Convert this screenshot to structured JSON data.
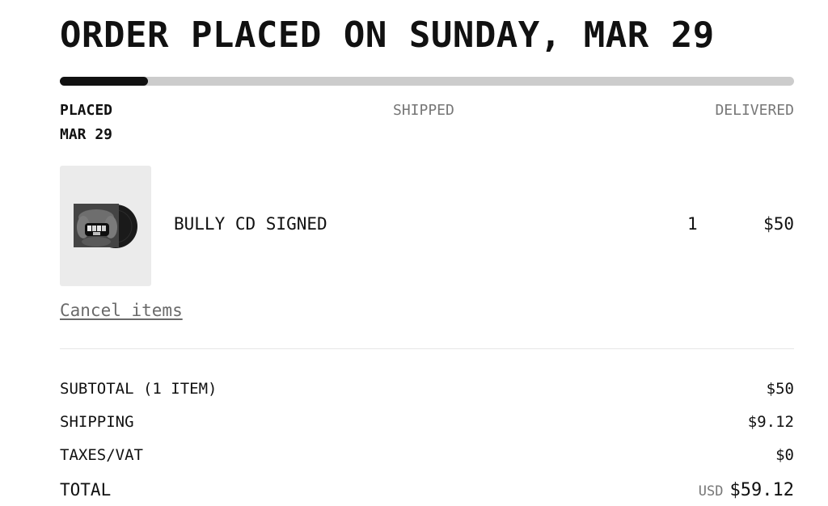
{
  "order": {
    "title": "ORDER PLACED ON SUNDAY, MAR 29",
    "progress_fraction": 0.12
  },
  "status_steps": [
    {
      "label": "PLACED",
      "date": "MAR 29"
    },
    {
      "label": "SHIPPED"
    },
    {
      "label": "DELIVERED"
    }
  ],
  "item": {
    "name": "BULLY CD SIGNED",
    "quantity": "1",
    "price": "$50",
    "image_icon": "album-cd-art"
  },
  "actions": {
    "cancel_label": "Cancel items"
  },
  "summary": {
    "subtotal_label": "SUBTOTAL (1 ITEM)",
    "subtotal_value": "$50",
    "shipping_label": "SHIPPING",
    "shipping_value": "$9.12",
    "taxes_label": "TAXES/VAT",
    "taxes_value": "$0",
    "total_label": "TOTAL",
    "total_currency": "USD",
    "total_value": "$59.12"
  },
  "colors": {
    "progress_fill": "#111111",
    "progress_track": "#cccccc",
    "muted_text": "#777777"
  }
}
